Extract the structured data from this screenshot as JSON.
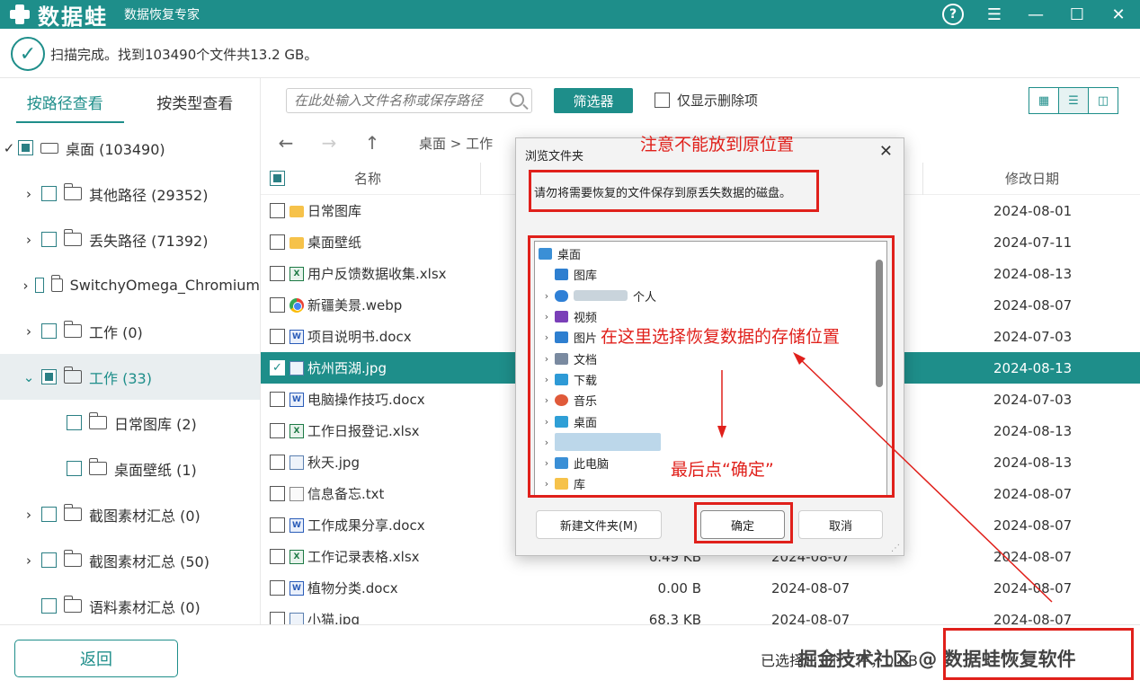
{
  "app": {
    "logo_text": "数据蛙",
    "subtitle": "数据恢复专家",
    "colors": {
      "accent": "#1e8e8a",
      "annotation_red": "#e0201b"
    }
  },
  "window_controls": {
    "help_icon": "?",
    "menu_icon": "☰",
    "minimize_icon": "—",
    "maximize_icon": "☐",
    "close_icon": "✕"
  },
  "status": {
    "text": "扫描完成。找到103490个文件共13.2 GB。",
    "icon": "check-circle-icon"
  },
  "left_panel": {
    "tabs": [
      {
        "label": "按路径查看",
        "active": true
      },
      {
        "label": "按类型查看",
        "active": false
      }
    ],
    "tree": [
      {
        "label": "桌面 (103490)",
        "chevron": "✓"
      },
      {
        "label": "其他路径 (29352)",
        "chevron": "›"
      },
      {
        "label": "丢失路径 (71392)",
        "chevron": "›"
      },
      {
        "label": "SwitchyOmega_Chromium",
        "chevron": "›"
      },
      {
        "label": "工作 (0)",
        "chevron": "›"
      },
      {
        "label": "工作 (33)",
        "chevron": "⌄"
      },
      {
        "label": "日常图库 (2)",
        "chevron": ""
      },
      {
        "label": "桌面壁纸 (1)",
        "chevron": ""
      },
      {
        "label": "截图素材汇总 (0)",
        "chevron": "›"
      },
      {
        "label": "截图素材汇总 (50)",
        "chevron": "›"
      },
      {
        "label": "语料素材汇总 (0)",
        "chevron": ""
      }
    ]
  },
  "toolbar": {
    "search_placeholder": "在此处输入文件名称或保存路径",
    "filter_label": "筛选器",
    "deleted_only_label": "仅显示删除项",
    "view_grid_icon": "▦",
    "view_list_icon": "☰",
    "view_detail_icon": "◫"
  },
  "nav": {
    "back_icon": "←",
    "forward_icon": "→",
    "up_icon": "↑",
    "breadcrumb": "桌面 > 工作"
  },
  "file_list": {
    "headers": {
      "name": "名称",
      "modified": "修改日期"
    },
    "rows": [
      {
        "name": "日常图库",
        "type": "folder",
        "size": "",
        "mdate": "",
        "date": "2024-08-01"
      },
      {
        "name": "桌面壁纸",
        "type": "folder",
        "size": "",
        "mdate": "",
        "date": "2024-07-11"
      },
      {
        "name": "用户反馈数据收集.xlsx",
        "type": "xlsx",
        "size": "",
        "mdate": "",
        "date": "2024-08-13"
      },
      {
        "name": "新疆美景.webp",
        "type": "webp",
        "size": "",
        "mdate": "",
        "date": "2024-08-07"
      },
      {
        "name": "项目说明书.docx",
        "type": "docx",
        "size": "",
        "mdate": "",
        "date": "2024-07-03"
      },
      {
        "name": "杭州西湖.jpg",
        "type": "jpg",
        "size": "",
        "mdate": "",
        "date": "2024-08-13",
        "selected": true
      },
      {
        "name": "电脑操作技巧.docx",
        "type": "docx",
        "size": "",
        "mdate": "",
        "date": "2024-07-03"
      },
      {
        "name": "工作日报登记.xlsx",
        "type": "xlsx",
        "size": "",
        "mdate": "",
        "date": "2024-08-13"
      },
      {
        "name": "秋天.jpg",
        "type": "jpg",
        "size": "",
        "mdate": "",
        "date": "2024-08-13"
      },
      {
        "name": "信息备忘.txt",
        "type": "txt",
        "size": "",
        "mdate": "",
        "date": "2024-08-07"
      },
      {
        "name": "工作成果分享.docx",
        "type": "docx",
        "size": "",
        "mdate": "",
        "date": "2024-08-07"
      },
      {
        "name": "工作记录表格.xlsx",
        "type": "xlsx",
        "size": "6.49 KB",
        "mdate": "2024-08-07",
        "date": "2024-08-07"
      },
      {
        "name": "植物分类.docx",
        "type": "docx",
        "size": "0.00  B",
        "mdate": "2024-08-07",
        "date": "2024-08-07"
      },
      {
        "name": "小猫.jpg",
        "type": "jpg",
        "size": "68.3 KB",
        "mdate": "2024-08-07",
        "date": "2024-08-07"
      }
    ]
  },
  "bottom": {
    "back_label": "返回",
    "selected_info": "已选择：1个文件，0 KB",
    "watermark": "掘金技术社区 @ 数据蛙恢复软件",
    "recover_label": "数据蛙恢复软件"
  },
  "dialog": {
    "title": "浏览文件夹",
    "close_icon": "✕",
    "note_annotation": "注意不能放到原位置",
    "message": "请勿将需要恢复的文件保存到原丢失数据的磁盘。",
    "tree": [
      {
        "label": "桌面",
        "chevron": "",
        "icon_color": "#3a8fd6"
      },
      {
        "label": "图库",
        "chevron": "",
        "icon_color": "#2e7fd0"
      },
      {
        "label": "个人",
        "chevron": "›",
        "icon_color": "#2f80d6",
        "blurred": true
      },
      {
        "label": "视频",
        "chevron": "›",
        "icon_color": "#7a3fb8"
      },
      {
        "label": "图片",
        "chevron": "›",
        "icon_color": "#2e7fd0"
      },
      {
        "label": "文档",
        "chevron": "›",
        "icon_color": "#7a8aa0"
      },
      {
        "label": "下载",
        "chevron": "›",
        "icon_color": "#2e9ad6"
      },
      {
        "label": "音乐",
        "chevron": "›",
        "icon_color": "#e05a3a"
      },
      {
        "label": "桌面",
        "chevron": "›",
        "icon_color": "#2f9fd6"
      },
      {
        "label": "",
        "chevron": "›",
        "icon_color": "#f6c24a",
        "blurred_selected": true
      },
      {
        "label": "此电脑",
        "chevron": "›",
        "icon_color": "#3a8fd6"
      },
      {
        "label": "库",
        "chevron": "›",
        "icon_color": "#f6c24a"
      }
    ],
    "tree_annotation": "在这里选择恢复数据的存储位置",
    "final_annotation": "最后点“确定”",
    "new_folder_label": "新建文件夹(M)",
    "ok_label": "确定",
    "cancel_label": "取消",
    "resize_icon": "⋰"
  }
}
